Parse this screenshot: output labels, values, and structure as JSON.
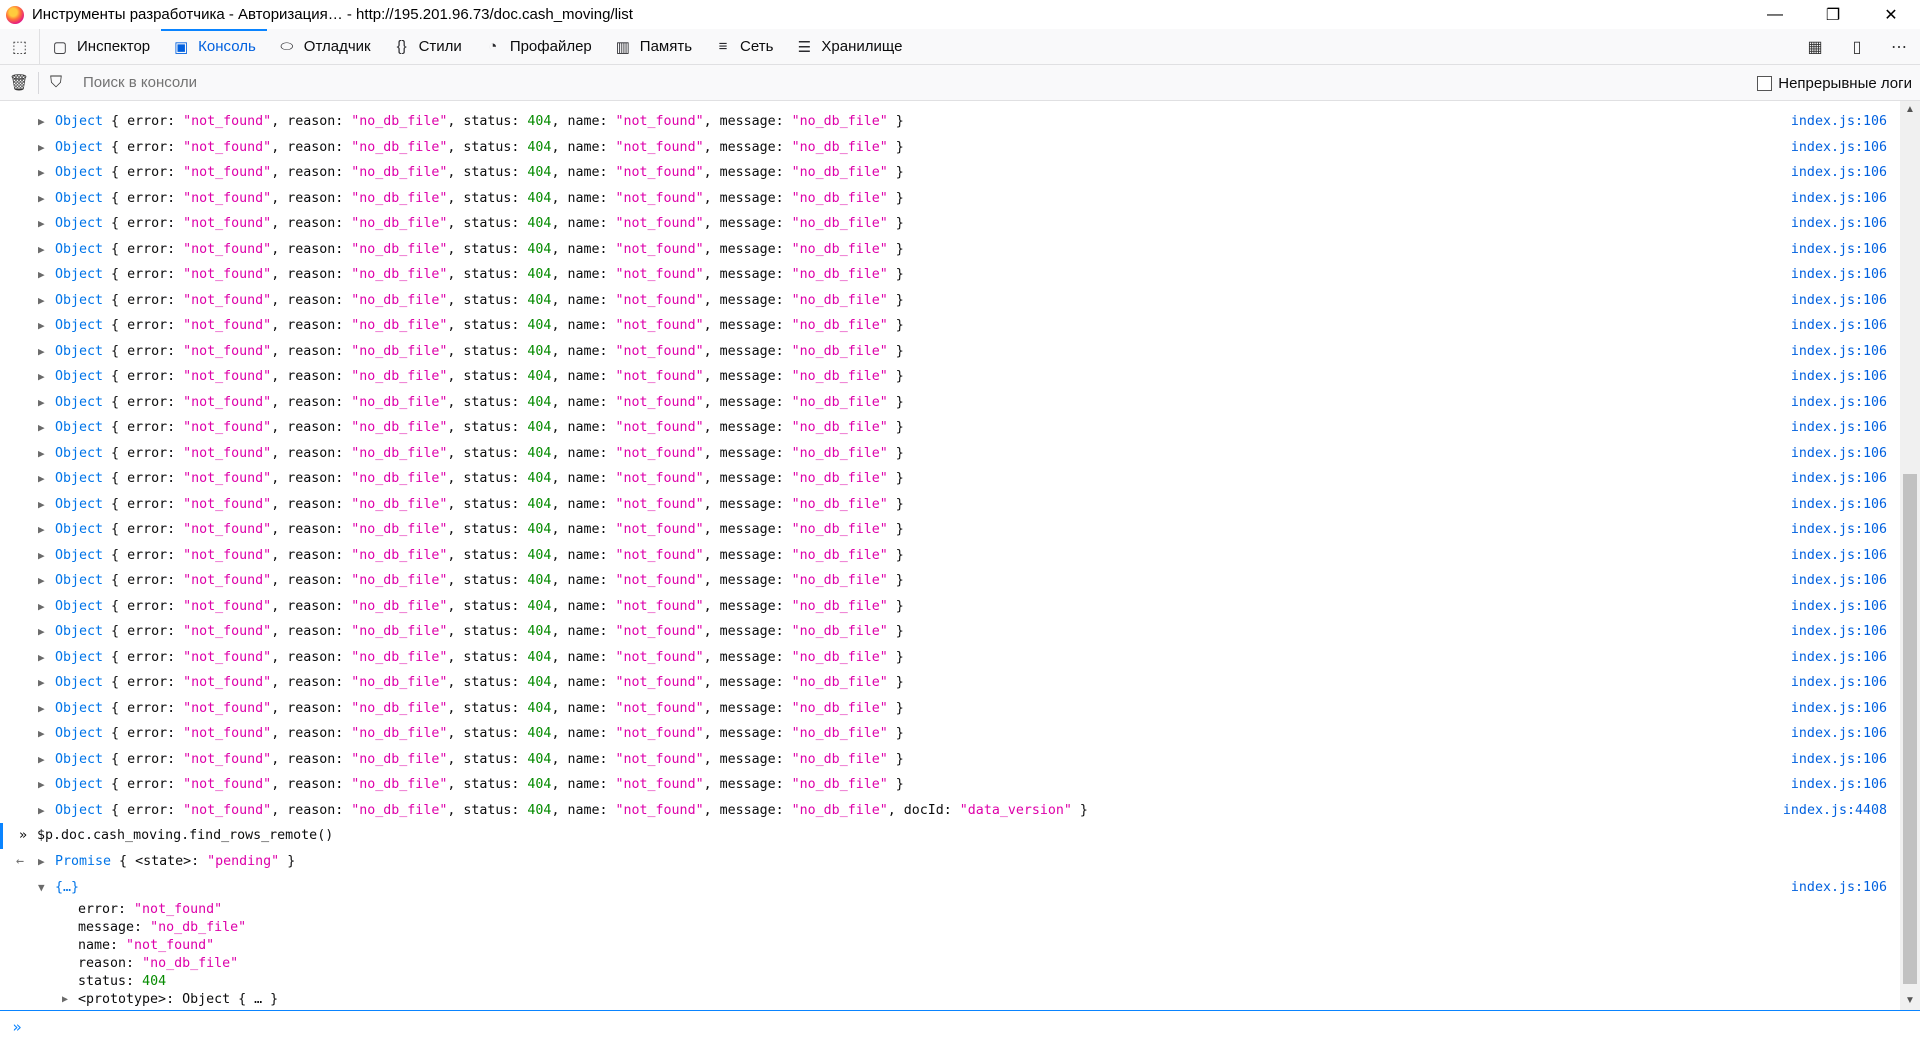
{
  "window": {
    "title": "Инструменты разработчика - Авторизация… - http://195.201.96.73/doc.cash_moving/list",
    "minimize": "—",
    "restore": "❐",
    "close": "✕"
  },
  "toolbar": {
    "pick_icon": "⬚",
    "tabs": [
      {
        "label": "Инспектор",
        "icon": "▢"
      },
      {
        "label": "Консоль",
        "icon": "▣"
      },
      {
        "label": "Отладчик",
        "icon": "⬭"
      },
      {
        "label": "Стили",
        "icon": "{}"
      },
      {
        "label": "Профайлер",
        "icon": "◔"
      },
      {
        "label": "Память",
        "icon": "▥"
      },
      {
        "label": "Сеть",
        "icon": "≡"
      },
      {
        "label": "Хранилище",
        "icon": "☰"
      }
    ],
    "right_icons": [
      "▦",
      "▯",
      "⋯"
    ]
  },
  "filter": {
    "placeholder": "Поиск в консоли",
    "persist_label": "Непрерывные логи"
  },
  "log": {
    "object_label": "Object",
    "keys": [
      "error",
      "reason",
      "status",
      "name",
      "message"
    ],
    "error": "\"not_found\"",
    "reason": "\"no_db_file\"",
    "status": "404",
    "name": "\"not_found\"",
    "message": "\"no_db_file\"",
    "docId_key": "docId",
    "docId": "\"data_version\"",
    "source": "index.js:106",
    "source_last": "index.js:4408"
  },
  "command": {
    "prompt": "»",
    "text": "$p.doc.cash_moving.find_rows_remote()"
  },
  "result": {
    "arrow": "←",
    "promise": "Promise",
    "state_key": "<state>",
    "state_value": "\"pending\""
  },
  "expanded": {
    "label": "{…}",
    "source": "index.js:106",
    "props": [
      {
        "key": "error",
        "value": "\"not_found\"",
        "type": "s"
      },
      {
        "key": "message",
        "value": "\"no_db_file\"",
        "type": "s"
      },
      {
        "key": "name",
        "value": "\"not_found\"",
        "type": "s"
      },
      {
        "key": "reason",
        "value": "\"no_db_file\"",
        "type": "s"
      },
      {
        "key": "status",
        "value": "404",
        "type": "n"
      }
    ],
    "proto_key": "<prototype>",
    "proto_value": "Object { … }"
  },
  "input": {
    "prompt": "»",
    "value": ""
  }
}
